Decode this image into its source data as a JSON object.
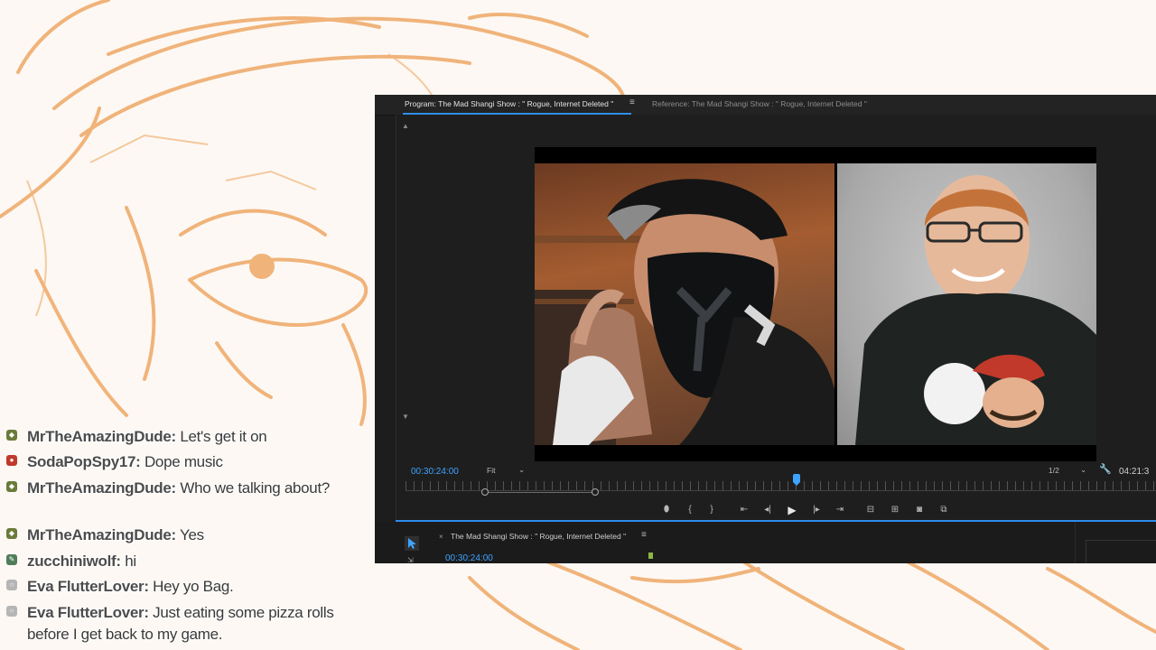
{
  "program_monitor": {
    "active_tab": "Program: The Mad Shangi Show : \" Rogue, Internet Deleted \"",
    "reference_tab": "Reference: The Mad Shangi Show : \" Rogue, Internet Deleted \"",
    "menu_glyph": "≡",
    "current_timecode": "00:30:24:00",
    "fit_option": "Fit",
    "resolution_option": "1/2",
    "duration_timecode": "04:21:3",
    "playhead_fraction": 0.52,
    "transport": {
      "marker": "⬮",
      "mark_in": "{",
      "mark_out": "}",
      "go_to_in": "⇤",
      "step_back": "◂|",
      "play": "▶",
      "step_forward": "|▸",
      "go_to_out": "⇥",
      "lift": "⊟",
      "extract": "⊞",
      "export_frame": "◙",
      "compare": "⧉"
    }
  },
  "timeline": {
    "close_glyph": "×",
    "sequence_tab": "The Mad Shangi Show : \" Rogue, Internet Deleted \"",
    "menu_glyph": "≡",
    "timecode": "00:30:24:00",
    "tool_hint": "⇲"
  },
  "chat": [
    {
      "username": "MrTheAmazingDude:",
      "message": " Let's get it on",
      "icon_color": "#6b7b3a"
    },
    {
      "username": "SodaPopSpy17:",
      "message": " Dope music",
      "icon_color": "#c0392b"
    },
    {
      "username": "MrTheAmazingDude:",
      "message": " Who we talking about?",
      "icon_color": "#6b7b3a"
    },
    {
      "username": "MrTheAmazingDude:",
      "message": " Yes",
      "icon_color": "#6b7b3a"
    },
    {
      "username": "zucchiniwolf:",
      "message": " hi",
      "icon_color": "#4f7d5a"
    },
    {
      "username": "Eva FlutterLover:",
      "message": " Hey yo Bag.",
      "icon_color": "#b5b5b5"
    },
    {
      "username": "Eva FlutterLover:",
      "message": " Just eating some pizza rolls before I get back to my game.",
      "icon_color": "#b5b5b5"
    }
  ],
  "colors": {
    "accent_blue": "#2d8ceb",
    "timecode_blue": "#3ea3ff",
    "sketch_orange": "#e8a35f"
  }
}
